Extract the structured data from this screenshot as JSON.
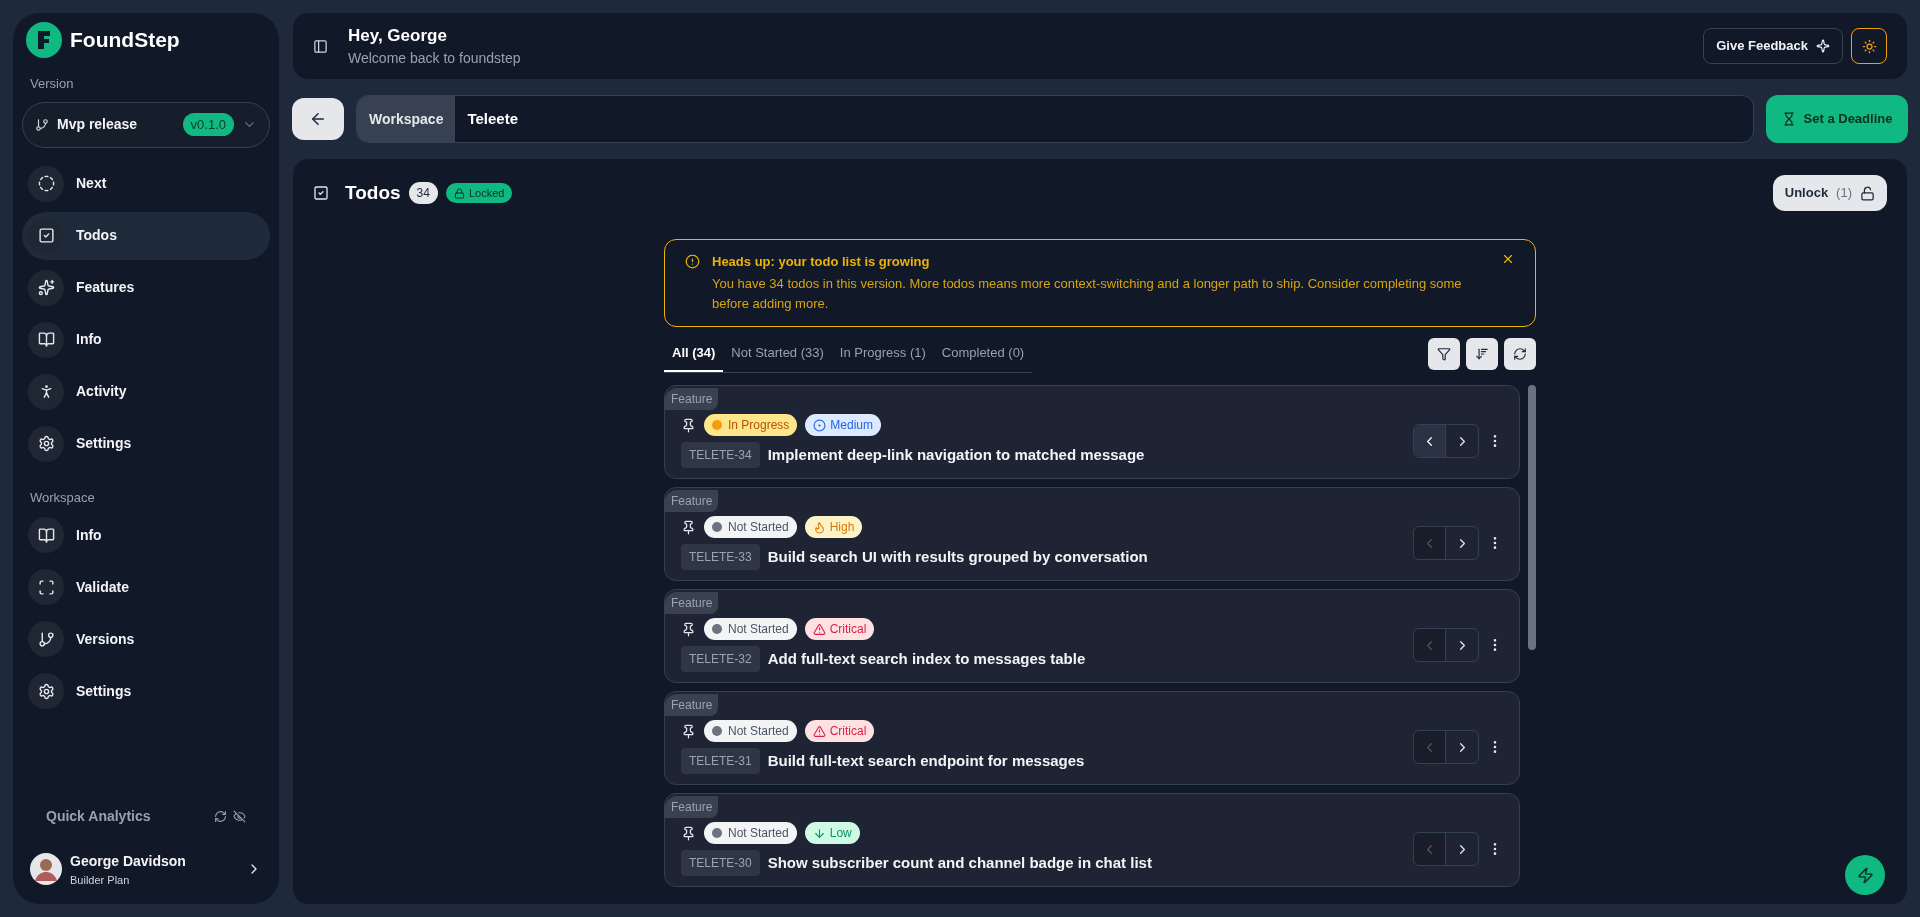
{
  "brand": {
    "name": "FoundStep"
  },
  "version": {
    "label": "Version",
    "name": "Mvp release",
    "tag": "v0.1.0"
  },
  "nav": [
    {
      "label": "Next",
      "selected": false
    },
    {
      "label": "Todos",
      "selected": true
    },
    {
      "label": "Features",
      "selected": false
    },
    {
      "label": "Info",
      "selected": false
    },
    {
      "label": "Activity",
      "selected": false
    },
    {
      "label": "Settings",
      "selected": false
    }
  ],
  "workspace": {
    "label": "Workspace",
    "items": [
      {
        "label": "Info",
        "selected": false
      },
      {
        "label": "Validate",
        "selected": false
      },
      {
        "label": "Versions",
        "selected": false
      },
      {
        "label": "Settings",
        "selected": false
      }
    ]
  },
  "quick_analytics": {
    "label": "Quick Analytics"
  },
  "user": {
    "name": "George Davidson",
    "plan": "Builder Plan"
  },
  "header": {
    "title": "Hey, George",
    "subtitle": "Welcome back to foundstep",
    "feedback": "Give Feedback"
  },
  "breadcrumb": {
    "section": "Workspace",
    "name": "Teleete",
    "deadline": "Set a Deadline"
  },
  "todos": {
    "title": "Todos",
    "count": "34",
    "lock": "Locked",
    "unlock": "Unlock",
    "unlock_count": "(1)"
  },
  "alert": {
    "title": "Heads up: your todo list is growing",
    "body": "You have 34 todos in this version. More todos means more context-switching and a longer path to ship. Consider completing some before adding more."
  },
  "tabs": [
    {
      "label": "All (34)",
      "selected": true
    },
    {
      "label": "Not Started (33)",
      "selected": false
    },
    {
      "label": "In Progress (1)",
      "selected": false
    },
    {
      "label": "Completed (0)",
      "selected": false
    }
  ],
  "items": [
    {
      "category": "Feature",
      "status": {
        "kind": "in_progress",
        "label": "In Progress"
      },
      "priority": {
        "kind": "medium",
        "label": "Medium"
      },
      "key": "TELETE-34",
      "title": "Implement deep-link navigation to matched message",
      "prev_disabled": false
    },
    {
      "category": "Feature",
      "status": {
        "kind": "not_started",
        "label": "Not Started"
      },
      "priority": {
        "kind": "high",
        "label": "High"
      },
      "key": "TELETE-33",
      "title": "Build search UI with results grouped by conversation",
      "prev_disabled": true
    },
    {
      "category": "Feature",
      "status": {
        "kind": "not_started",
        "label": "Not Started"
      },
      "priority": {
        "kind": "critical",
        "label": "Critical"
      },
      "key": "TELETE-32",
      "title": "Add full-text search index to messages table",
      "prev_disabled": true
    },
    {
      "category": "Feature",
      "status": {
        "kind": "not_started",
        "label": "Not Started"
      },
      "priority": {
        "kind": "critical",
        "label": "Critical"
      },
      "key": "TELETE-31",
      "title": "Build full-text search endpoint for messages",
      "prev_disabled": true
    },
    {
      "category": "Feature",
      "status": {
        "kind": "not_started",
        "label": "Not Started"
      },
      "priority": {
        "kind": "low",
        "label": "Low"
      },
      "key": "TELETE-30",
      "title": "Show subscriber count and channel badge in chat list",
      "prev_disabled": true
    }
  ]
}
